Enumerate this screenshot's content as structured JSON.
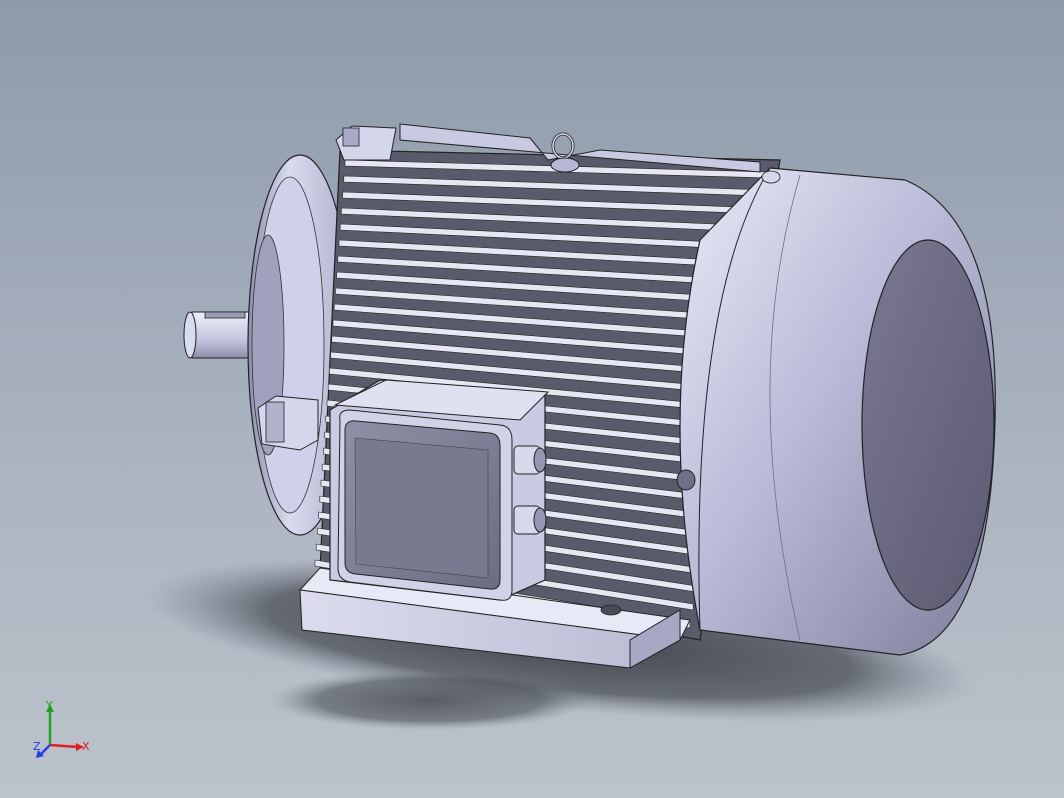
{
  "viewport": {
    "background_top": "#8e9aaa",
    "background_bottom": "#bcc3cc"
  },
  "model": {
    "subject": "electric-motor-3d-model",
    "colors": {
      "body": "#c9cbe6",
      "body_shade": "#7d7f9a",
      "fan_cover_face": "#6a6880",
      "fins_dark": "#4a4b58",
      "fins_light": "#e6e7f2",
      "shadow": "#3f434b"
    }
  },
  "triad": {
    "x_label": "X",
    "y_label": "Y",
    "z_label": "Z",
    "x_color": "#e02020",
    "y_color": "#20a020",
    "z_color": "#2040e0"
  }
}
